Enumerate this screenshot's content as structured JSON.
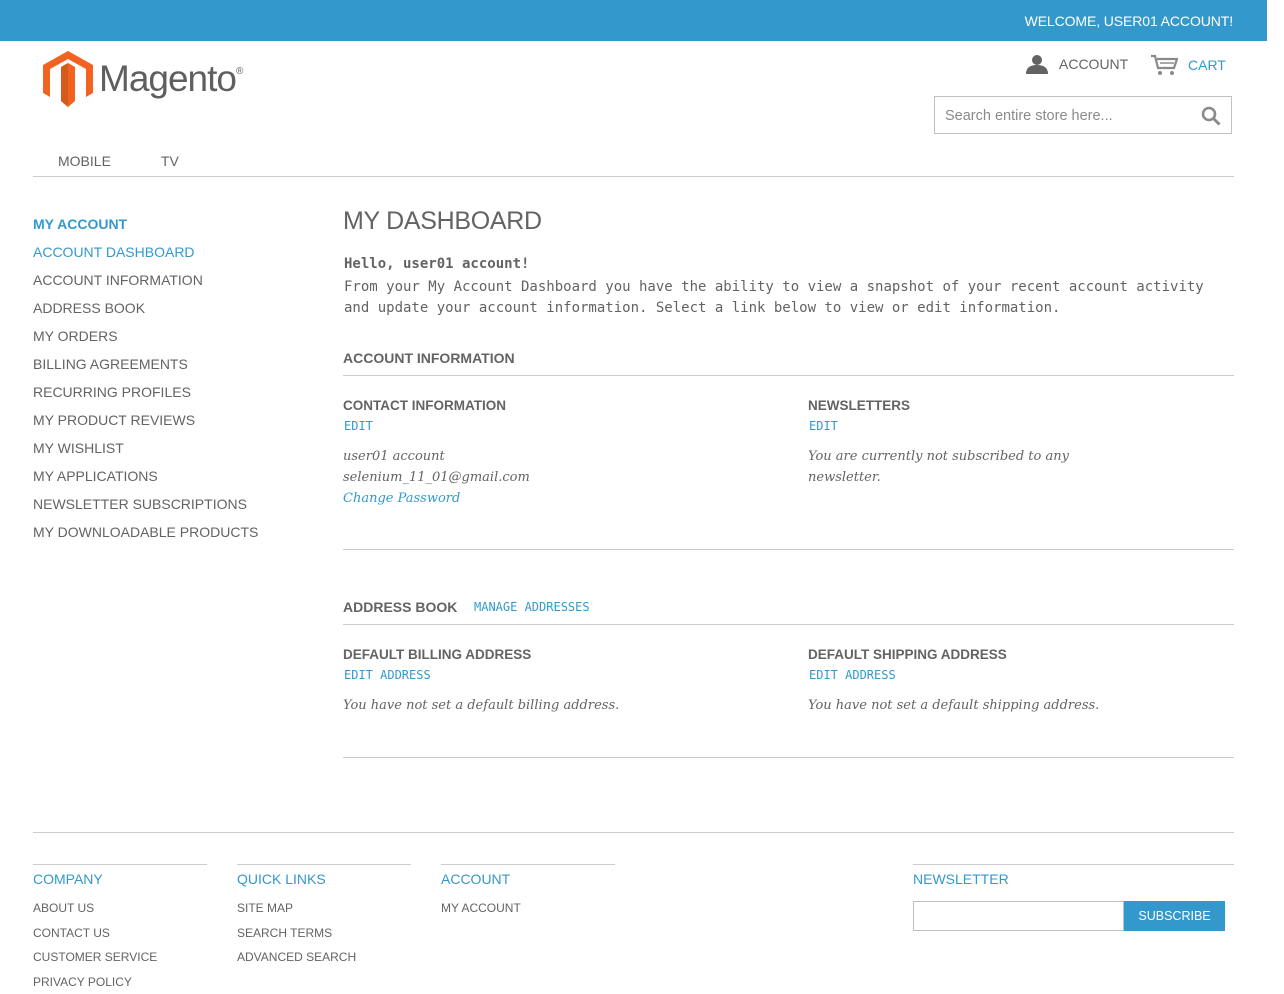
{
  "header": {
    "welcome": "WELCOME, USER01 ACCOUNT!",
    "logo_text": "Magento",
    "account_label": "ACCOUNT",
    "cart_label": "CART",
    "search_placeholder": "Search entire store here..."
  },
  "nav": [
    "MOBILE",
    "TV"
  ],
  "sidebar": {
    "title": "MY ACCOUNT",
    "items": [
      "ACCOUNT DASHBOARD",
      "ACCOUNT INFORMATION",
      "ADDRESS BOOK",
      "MY ORDERS",
      "BILLING AGREEMENTS",
      "RECURRING PROFILES",
      "MY PRODUCT REVIEWS",
      "MY WISHLIST",
      "MY APPLICATIONS",
      "NEWSLETTER SUBSCRIPTIONS",
      "MY DOWNLOADABLE PRODUCTS"
    ]
  },
  "dashboard": {
    "title": "MY DASHBOARD",
    "hello": "Hello, user01 account!",
    "intro": "From your My Account Dashboard you have the ability to view a snapshot of your recent account activity and update your account information. Select a link below to view or edit information.",
    "account_info": {
      "title": "ACCOUNT INFORMATION",
      "contact_title": "CONTACT INFORMATION",
      "contact_edit": "EDIT",
      "name": "user01 account",
      "email": "selenium_11_01@gmail.com",
      "change_password": "Change Password",
      "newsletters_title": "NEWSLETTERS",
      "newsletters_edit": "EDIT",
      "newsletters_text": "You are currently not subscribed to any newsletter."
    },
    "address_book": {
      "title": "ADDRESS BOOK",
      "manage": "MANAGE ADDRESSES",
      "billing_title": "DEFAULT BILLING ADDRESS",
      "billing_edit": "EDIT ADDRESS",
      "billing_text": "You have not set a default billing address.",
      "shipping_title": "DEFAULT SHIPPING ADDRESS",
      "shipping_edit": "EDIT ADDRESS",
      "shipping_text": "You have not set a default shipping address."
    }
  },
  "footer": {
    "company": {
      "title": "COMPANY",
      "items": [
        "ABOUT US",
        "CONTACT US",
        "CUSTOMER SERVICE",
        "PRIVACY POLICY"
      ]
    },
    "quick_links": {
      "title": "QUICK LINKS",
      "items": [
        "SITE MAP",
        "SEARCH TERMS",
        "ADVANCED SEARCH"
      ]
    },
    "account": {
      "title": "ACCOUNT",
      "items": [
        "MY ACCOUNT"
      ]
    },
    "newsletter": {
      "title": "NEWSLETTER",
      "button": "SUBSCRIBE"
    }
  },
  "colors": {
    "accent": "#3399cc",
    "text": "#636363",
    "logo_orange": "#f26322"
  },
  "icons": [
    "magento-logo-icon",
    "account-icon",
    "cart-icon",
    "search-icon"
  ]
}
